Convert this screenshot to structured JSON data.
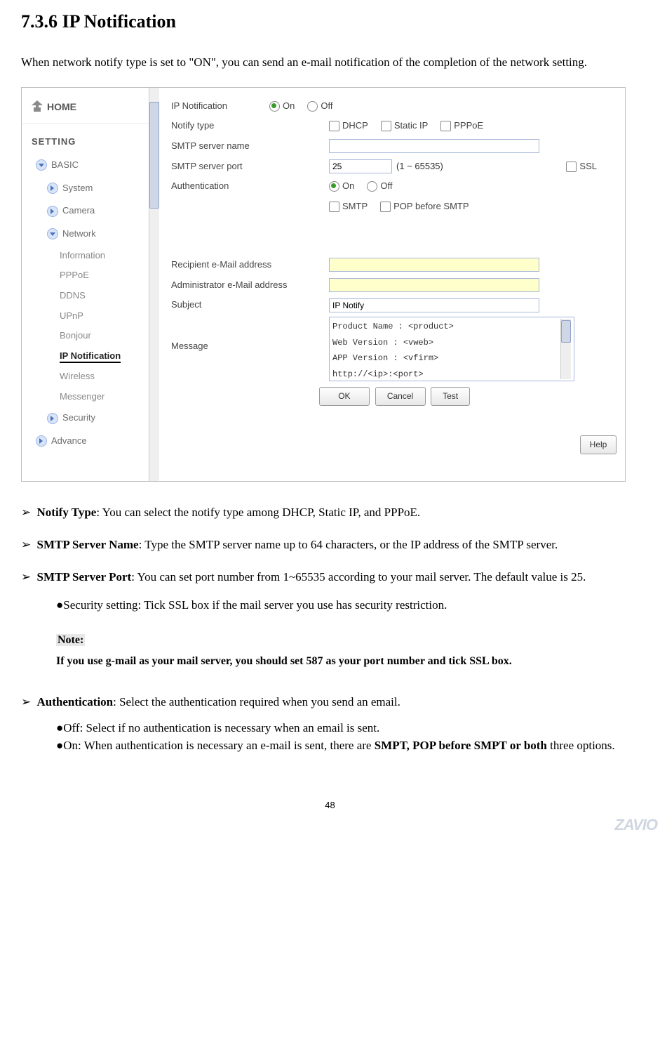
{
  "heading": "7.3.6 IP Notification",
  "intro": "When network notify type is set to \"ON\", you can send an e-mail notification of the completion of the network setting.",
  "sidebar": {
    "home": "HOME",
    "setting": "SETTING",
    "items": [
      {
        "label": "BASIC",
        "expanded": false
      },
      {
        "label": "System"
      },
      {
        "label": "Camera"
      },
      {
        "label": "Network",
        "expanded": true
      },
      {
        "label": "Security"
      },
      {
        "label": "Advance"
      }
    ],
    "network_subs": [
      {
        "label": "Information"
      },
      {
        "label": "PPPoE"
      },
      {
        "label": "DDNS"
      },
      {
        "label": "UPnP"
      },
      {
        "label": "Bonjour"
      },
      {
        "label": "IP Notification",
        "active": true
      },
      {
        "label": "Wireless"
      },
      {
        "label": "Messenger"
      }
    ]
  },
  "form": {
    "ip_notification_label": "IP Notification",
    "on": "On",
    "off": "Off",
    "notify_type": "Notify type",
    "dhcp": "DHCP",
    "static_ip": "Static IP",
    "pppoe": "PPPoE",
    "smtp_name": "SMTP server name",
    "smtp_port": "SMTP server port",
    "port_value": "25",
    "port_range": "(1 ~ 65535)",
    "ssl": "SSL",
    "auth": "Authentication",
    "smtp": "SMTP",
    "pop": "POP before SMTP",
    "recipient": "Recipient e-Mail address",
    "admin": "Administrator e-Mail address",
    "subject": "Subject",
    "subject_val": "IP Notify",
    "message": "Message",
    "message_val": "Product Name : <product>\nWeb Version : <vweb>\nAPP Version : <vfirm>\nhttp://<ip>:<port>\nMAC Address : <mac>",
    "ok": "OK",
    "cancel": "Cancel",
    "test": "Test",
    "help": "Help"
  },
  "body": {
    "b1_lead": "Notify Type",
    "b1_rest": ": You can select the notify type among DHCP, Static IP, and PPPoE.",
    "b2_lead": "SMTP Server Name",
    "b2_rest": ": Type the SMTP server name up to 64 characters, or the IP address of the SMTP server.",
    "b3_lead": "SMTP Server Port",
    "b3_rest": ": You can set port number from 1~65535 according to your mail server. The default value is 25.",
    "sub1": "Security setting: Tick SSL box if the mail server you use has security restriction.",
    "note_label": "Note:",
    "note_body": "If you use g-mail as your mail server, you should set 587 as your port number and tick SSL box.",
    "b4_lead": "Authentication",
    "b4_rest": ": Select the authentication required when you send an email.",
    "sub2": "Off: Select if no authentication is necessary when an email is sent.",
    "sub3_a": "On: When authentication is necessary an e-mail is sent, there are ",
    "sub3_b": "SMPT, POP before SMPT or both",
    "sub3_c": " three options."
  },
  "page_number": "48",
  "brand": "ZAVIO"
}
